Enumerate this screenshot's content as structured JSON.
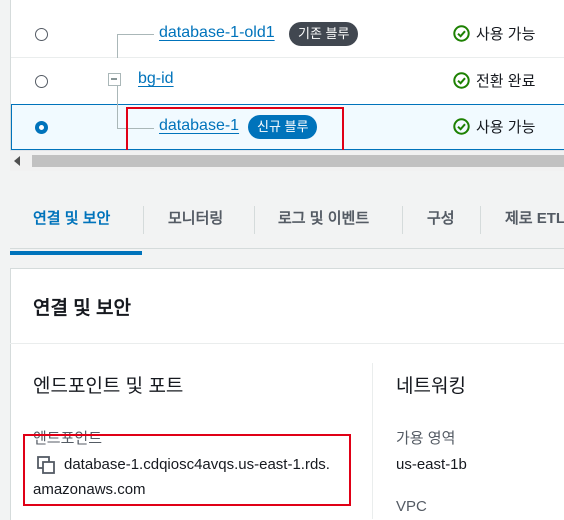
{
  "table": {
    "rows": [
      {
        "name": "database-1-old1",
        "badge": "기존 블루",
        "status": "사용 가능",
        "selected": false
      },
      {
        "name": "bg-id",
        "badge": "",
        "status": "전환 완료",
        "selected": false
      },
      {
        "name": "database-1",
        "badge": "신규 블루",
        "status": "사용 가능",
        "selected": true
      }
    ]
  },
  "colors": {
    "accent": "#0073bb",
    "badge_dark": "#414750",
    "status_green": "#1d8102",
    "highlight_red": "#e00016"
  },
  "tabs": [
    {
      "label": "연결 및 보안",
      "active": true
    },
    {
      "label": "모니터링",
      "active": false
    },
    {
      "label": "로그 및 이벤트",
      "active": false
    },
    {
      "label": "구성",
      "active": false
    },
    {
      "label": "제로 ETL",
      "active": false
    }
  ],
  "card": {
    "title": "연결 및 보안",
    "endpoint_section": {
      "heading": "엔드포인트 및 포트",
      "endpoint_label": "엔드포인트",
      "endpoint_line1": "database-1.cdqiosc4avqs.us-east-1.rds.",
      "endpoint_line2": "amazonaws.com",
      "copy_icon": "copy-icon"
    },
    "network_section": {
      "heading": "네트워킹",
      "az_label": "가용 영역",
      "az_value": "us-east-1b",
      "vpc_label": "VPC"
    }
  }
}
